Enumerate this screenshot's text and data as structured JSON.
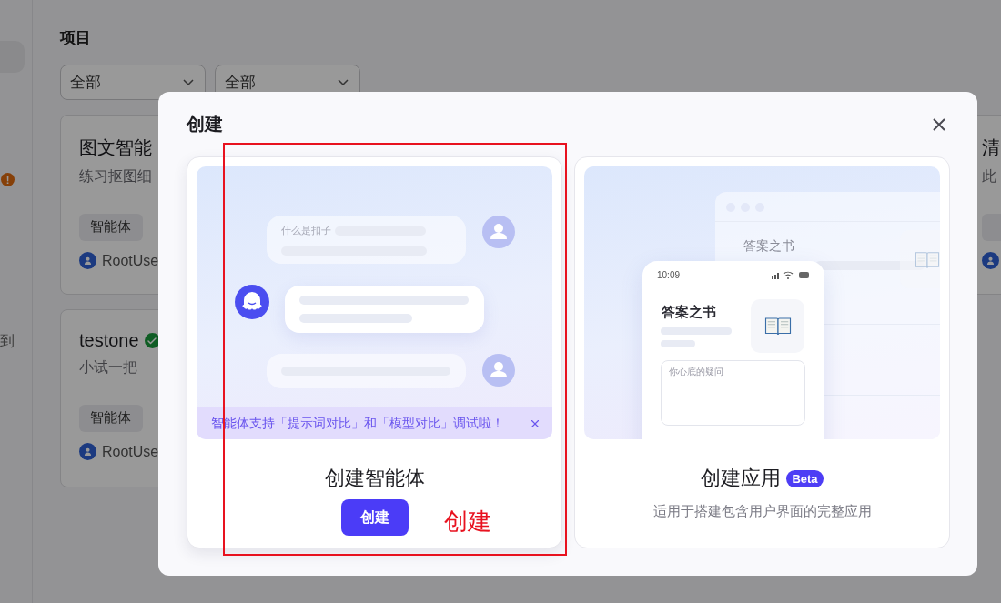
{
  "sidebar": {
    "alert_badge": "!",
    "label": "到"
  },
  "section_title": "项目",
  "filters": [
    {
      "value": "全部"
    },
    {
      "value": "全部"
    }
  ],
  "projects": [
    {
      "title": "图文智能",
      "description": "练习抠图细",
      "tag": "智能体",
      "owner": "RootUse"
    },
    {
      "title": "testone",
      "description": "小试一把",
      "tag": "智能体",
      "owner": "RootUse",
      "verified": true
    },
    {
      "title": "清",
      "description": "此"
    }
  ],
  "dialog": {
    "title": "创建",
    "options": [
      {
        "kind": "agent",
        "title": "创建智能体",
        "button": "创建",
        "sample_question": "什么是扣子",
        "banner": "智能体支持「提示词对比」和「模型对比」调试啦！"
      },
      {
        "kind": "app",
        "title": "创建应用",
        "badge": "Beta",
        "description": "适用于搭建包含用户界面的完整应用",
        "window_title": "答案之书",
        "phone_time": "10:09",
        "phone_title": "答案之书",
        "input_placeholder": "你心底的疑问"
      }
    ]
  },
  "annotation": {
    "label": "创建"
  }
}
